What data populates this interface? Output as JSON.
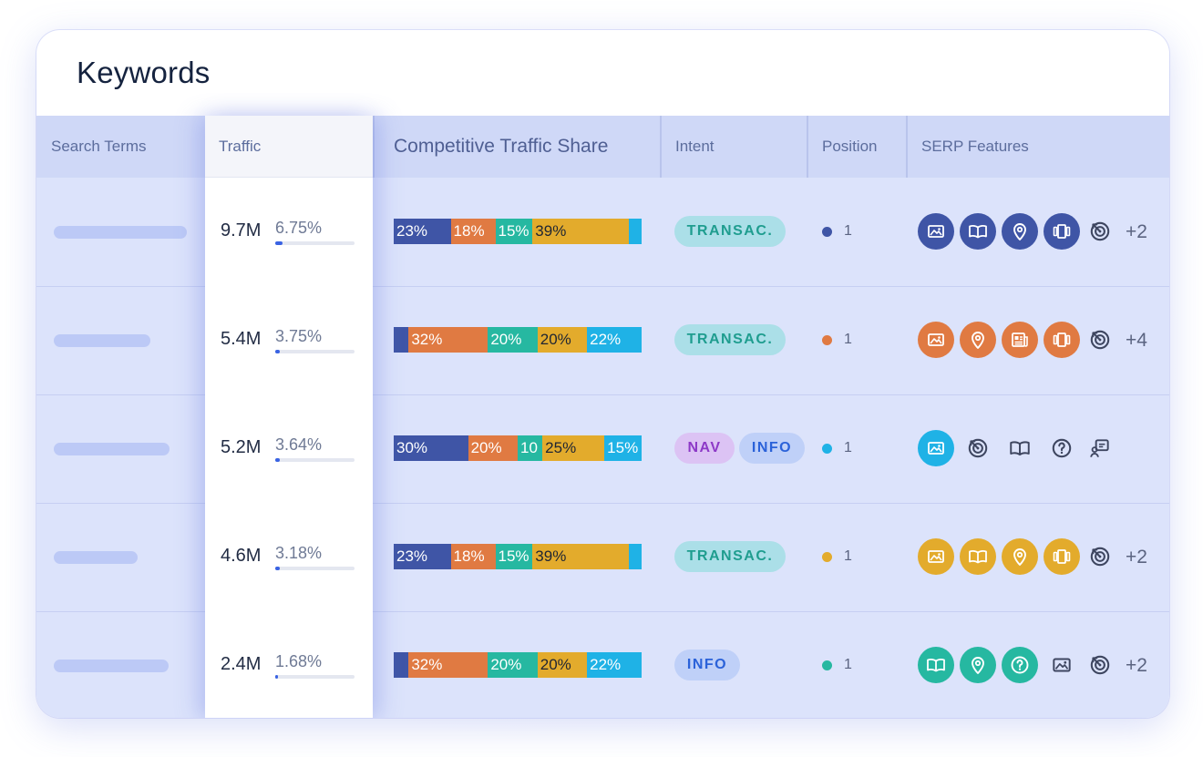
{
  "card": {
    "title": "Keywords"
  },
  "headers": {
    "search_terms": "Search Terms",
    "traffic": "Traffic",
    "share": "Competitive Traffic Share",
    "intent": "Intent",
    "position": "Position",
    "serp": "SERP Features"
  },
  "colors": {
    "navy": "#3f55a6",
    "orange": "#e07a42",
    "teal": "#26b8a1",
    "gold": "#e3ab2c",
    "cyan": "#1fb2e6"
  },
  "rows": [
    {
      "traffic": "9.7M",
      "percent": "6.75%",
      "percent_value": 6.75,
      "share": [
        {
          "label": "23%",
          "value": 23,
          "color": "#3f55a6"
        },
        {
          "label": "18%",
          "value": 18,
          "color": "#e07a42"
        },
        {
          "label": "15%",
          "value": 15,
          "color": "#26b8a1"
        },
        {
          "label": "39%",
          "value": 39,
          "color": "#e3ab2c",
          "dark": true
        },
        {
          "label": "",
          "value": 5,
          "color": "#1fb2e6"
        }
      ],
      "intents": [
        {
          "label": "TRANSAC.",
          "kind": "transac"
        }
      ],
      "position_color": "#3f55a6",
      "position": "1",
      "features": [
        {
          "icon": "image-icon",
          "filled": true
        },
        {
          "icon": "book-icon",
          "filled": true
        },
        {
          "icon": "map-pin-icon",
          "filled": true
        },
        {
          "icon": "carousel-icon",
          "filled": true
        },
        {
          "icon": "target-icon",
          "filled": false
        }
      ],
      "feature_color": "#3f55a6",
      "more": "+2"
    },
    {
      "traffic": "5.4M",
      "percent": "3.75%",
      "percent_value": 3.75,
      "share": [
        {
          "label": "",
          "value": 6,
          "color": "#3f55a6"
        },
        {
          "label": "32%",
          "value": 32,
          "color": "#e07a42"
        },
        {
          "label": "20%",
          "value": 20,
          "color": "#26b8a1"
        },
        {
          "label": "20%",
          "value": 20,
          "color": "#e3ab2c",
          "dark": true
        },
        {
          "label": "22%",
          "value": 22,
          "color": "#1fb2e6"
        }
      ],
      "intents": [
        {
          "label": "TRANSAC.",
          "kind": "transac"
        }
      ],
      "position_color": "#e07a42",
      "position": "1",
      "features": [
        {
          "icon": "image-icon",
          "filled": true
        },
        {
          "icon": "map-pin-icon",
          "filled": true
        },
        {
          "icon": "news-icon",
          "filled": true
        },
        {
          "icon": "carousel-icon",
          "filled": true
        },
        {
          "icon": "target-icon",
          "filled": false
        }
      ],
      "feature_color": "#e07a42",
      "more": "+4"
    },
    {
      "traffic": "5.2M",
      "percent": "3.64%",
      "percent_value": 3.64,
      "share": [
        {
          "label": "30%",
          "value": 30,
          "color": "#3f55a6"
        },
        {
          "label": "20%",
          "value": 20,
          "color": "#e07a42"
        },
        {
          "label": "10",
          "value": 10,
          "color": "#26b8a1"
        },
        {
          "label": "25%",
          "value": 25,
          "color": "#e3ab2c",
          "dark": true
        },
        {
          "label": "15%",
          "value": 15,
          "color": "#1fb2e6"
        }
      ],
      "intents": [
        {
          "label": "NAV",
          "kind": "nav"
        },
        {
          "label": "INFO",
          "kind": "info"
        }
      ],
      "position_color": "#1fb2e6",
      "position": "1",
      "features": [
        {
          "icon": "image-icon",
          "filled": true
        },
        {
          "icon": "target-icon",
          "filled": false
        },
        {
          "icon": "book-icon",
          "filled": false
        },
        {
          "icon": "question-icon",
          "filled": false
        },
        {
          "icon": "review-icon",
          "filled": false
        }
      ],
      "feature_color": "#1fb2e6",
      "more": ""
    },
    {
      "traffic": "4.6M",
      "percent": "3.18%",
      "percent_value": 3.18,
      "share": [
        {
          "label": "23%",
          "value": 23,
          "color": "#3f55a6"
        },
        {
          "label": "18%",
          "value": 18,
          "color": "#e07a42"
        },
        {
          "label": "15%",
          "value": 15,
          "color": "#26b8a1"
        },
        {
          "label": "39%",
          "value": 39,
          "color": "#e3ab2c",
          "dark": true
        },
        {
          "label": "",
          "value": 5,
          "color": "#1fb2e6"
        }
      ],
      "intents": [
        {
          "label": "TRANSAC.",
          "kind": "transac"
        }
      ],
      "position_color": "#e3ab2c",
      "position": "1",
      "features": [
        {
          "icon": "image-icon",
          "filled": true
        },
        {
          "icon": "book-icon",
          "filled": true
        },
        {
          "icon": "map-pin-icon",
          "filled": true
        },
        {
          "icon": "carousel-icon",
          "filled": true
        },
        {
          "icon": "target-icon",
          "filled": false
        }
      ],
      "feature_color": "#e3ab2c",
      "more": "+2"
    },
    {
      "traffic": "2.4M",
      "percent": "1.68%",
      "percent_value": 1.68,
      "share": [
        {
          "label": "",
          "value": 6,
          "color": "#3f55a6"
        },
        {
          "label": "32%",
          "value": 32,
          "color": "#e07a42"
        },
        {
          "label": "20%",
          "value": 20,
          "color": "#26b8a1"
        },
        {
          "label": "20%",
          "value": 20,
          "color": "#e3ab2c",
          "dark": true
        },
        {
          "label": "22%",
          "value": 22,
          "color": "#1fb2e6"
        }
      ],
      "intents": [
        {
          "label": "INFO",
          "kind": "info"
        }
      ],
      "position_color": "#26b8a1",
      "position": "1",
      "features": [
        {
          "icon": "book-icon",
          "filled": true
        },
        {
          "icon": "map-pin-icon",
          "filled": true
        },
        {
          "icon": "question-icon",
          "filled": true
        },
        {
          "icon": "image-icon",
          "filled": false
        },
        {
          "icon": "target-icon",
          "filled": false
        }
      ],
      "feature_color": "#26b8a1",
      "more": "+2"
    }
  ]
}
